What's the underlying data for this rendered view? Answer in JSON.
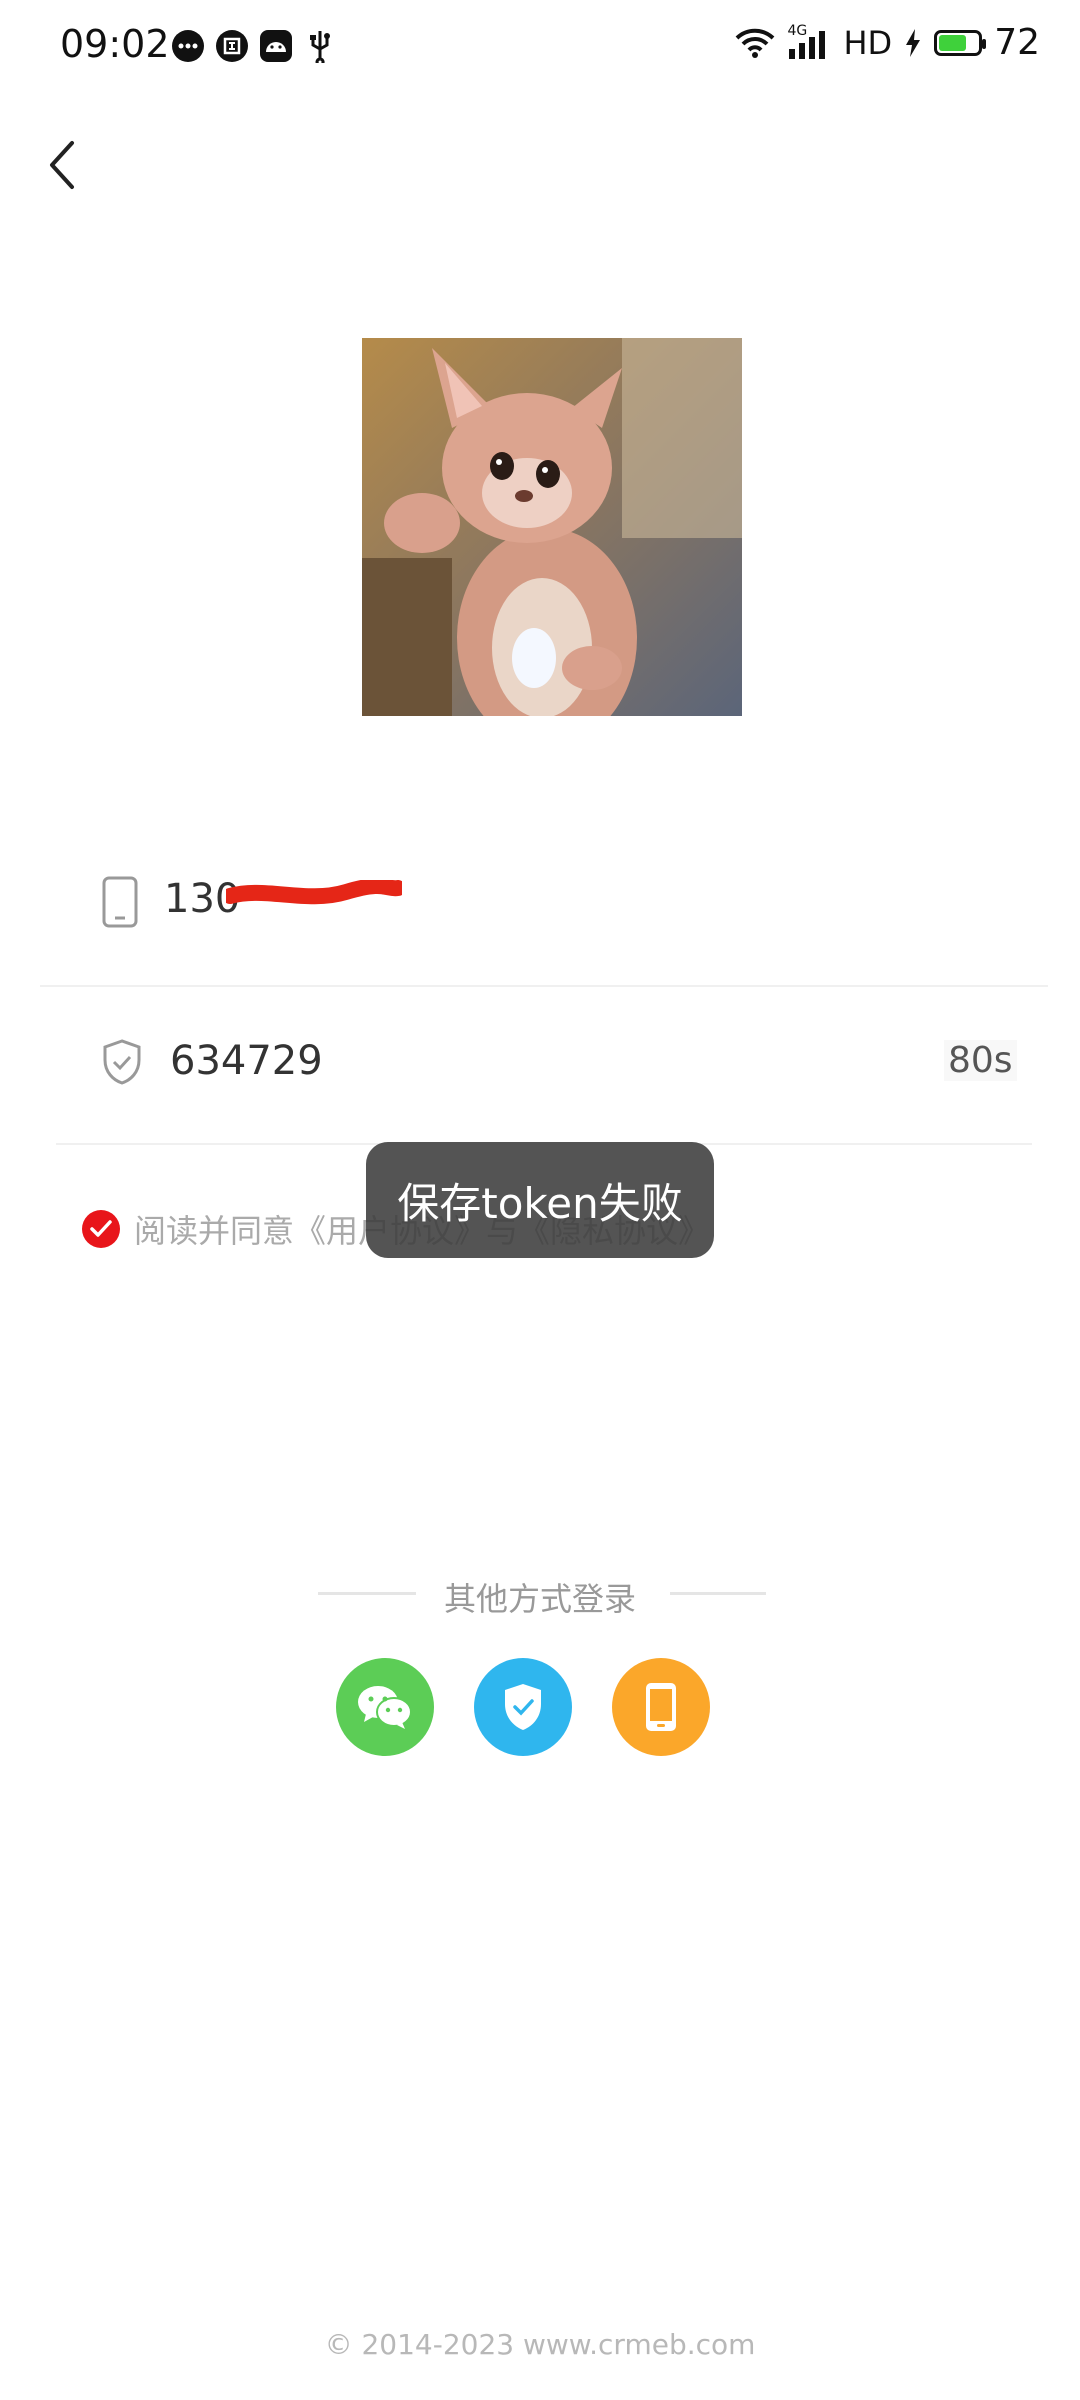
{
  "status_bar": {
    "time": "09:02",
    "network": "4G",
    "hd": "HD",
    "battery": "72",
    "battery_level": 0.72
  },
  "nav": {
    "back_icon": "chevron-left-icon"
  },
  "avatar": {
    "description_icon": "cartoon-fox-avatar"
  },
  "form": {
    "phone_value": "130",
    "code_value": "634729",
    "countdown": "80s"
  },
  "agreement": {
    "text": "阅读并同意《用户协议》与《隐私协议》",
    "checked": true
  },
  "toast": {
    "message": "保存token失败"
  },
  "other_login": {
    "label": "其他方式登录",
    "methods": [
      {
        "name": "wechat",
        "icon": "wechat-icon",
        "color": "#5ccd56"
      },
      {
        "name": "shield",
        "icon": "shield-check-icon",
        "color": "#2fb6ee"
      },
      {
        "name": "phone",
        "icon": "phone-icon",
        "color": "#fba72a"
      }
    ]
  },
  "footer": {
    "copyright": "© 2014-2023  www.crmeb.com"
  },
  "colors": {
    "accent": "#e8151a",
    "toast_bg": "#3c3c3c"
  }
}
